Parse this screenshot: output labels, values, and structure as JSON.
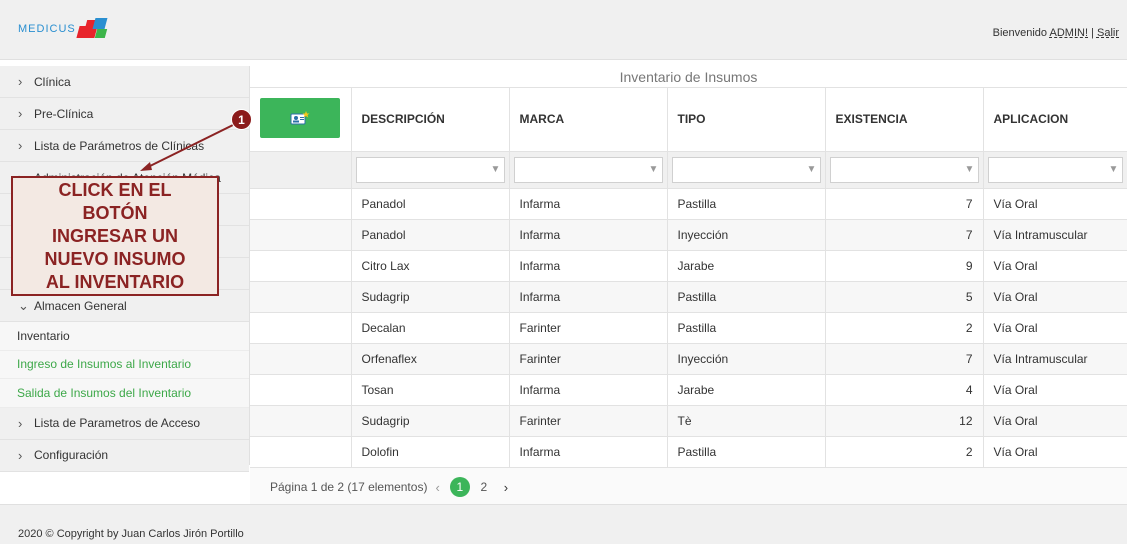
{
  "header": {
    "logo_text": "MEDICUS",
    "welcome": "Bienvenido",
    "user": "ADMIN!",
    "separator": "|",
    "logout": "Salir"
  },
  "sidebar": {
    "items_top": [
      {
        "label": "Clínica"
      },
      {
        "label": "Pre-Clínica"
      },
      {
        "label": "Lista de Parámetros de Clínicas"
      },
      {
        "label": "Administración de Atención Médica"
      },
      {
        "label": ""
      },
      {
        "label": ""
      },
      {
        "label": ""
      }
    ],
    "expanded": {
      "label": "Almacen General"
    },
    "sub_items": [
      {
        "label": "Inventario"
      },
      {
        "label": "Ingreso de Insumos al Inventario"
      },
      {
        "label": "Salida de Insumos del Inventario"
      }
    ],
    "items_bottom": [
      {
        "label": "Lista de Parametros de Acceso"
      },
      {
        "label": "Configuración"
      }
    ]
  },
  "grid": {
    "title": "Inventario de Insumos",
    "new_button_icon": "add-user-icon",
    "columns": [
      "DESCRIPCIÓN",
      "MARCA",
      "TIPO",
      "EXISTENCIA",
      "APLICACION"
    ],
    "rows": [
      [
        "Panadol",
        "Infarma",
        "Pastilla",
        "7",
        "Vía Oral"
      ],
      [
        "Panadol",
        "Infarma",
        "Inyección",
        "7",
        "Vía Intramuscular"
      ],
      [
        "Citro Lax",
        "Infarma",
        "Jarabe",
        "9",
        "Vía Oral"
      ],
      [
        "Sudagrip",
        "Infarma",
        "Pastilla",
        "5",
        "Vía Oral"
      ],
      [
        "Decalan",
        "Farinter",
        "Pastilla",
        "2",
        "Vía Oral"
      ],
      [
        "Orfenaflex",
        "Farinter",
        "Inyección",
        "7",
        "Vía Intramuscular"
      ],
      [
        "Tosan",
        "Infarma",
        "Jarabe",
        "4",
        "Vía Oral"
      ],
      [
        "Sudagrip",
        "Farinter",
        "Tè",
        "12",
        "Vía Oral"
      ],
      [
        "Dolofin",
        "Infarma",
        "Pastilla",
        "2",
        "Vía Oral"
      ]
    ]
  },
  "pager": {
    "summary": "Página 1 de 2 (17 elementos)",
    "prev": "‹",
    "pages": [
      "1",
      "2"
    ],
    "next": "›"
  },
  "footer": {
    "copyright": "2020 © Copyright by Juan Carlos Jirón Portillo"
  },
  "annotation": {
    "step": "1",
    "lines": [
      "CLICK EN EL",
      "BOTÓN",
      "INGRESAR UN",
      "NUEVO INSUMO",
      "AL INVENTARIO"
    ]
  },
  "colors": {
    "accent_green": "#3cb55a",
    "annotation_red": "#8b2323",
    "logo_blue": "#2a8fd0",
    "logo_red": "#e8242b"
  }
}
